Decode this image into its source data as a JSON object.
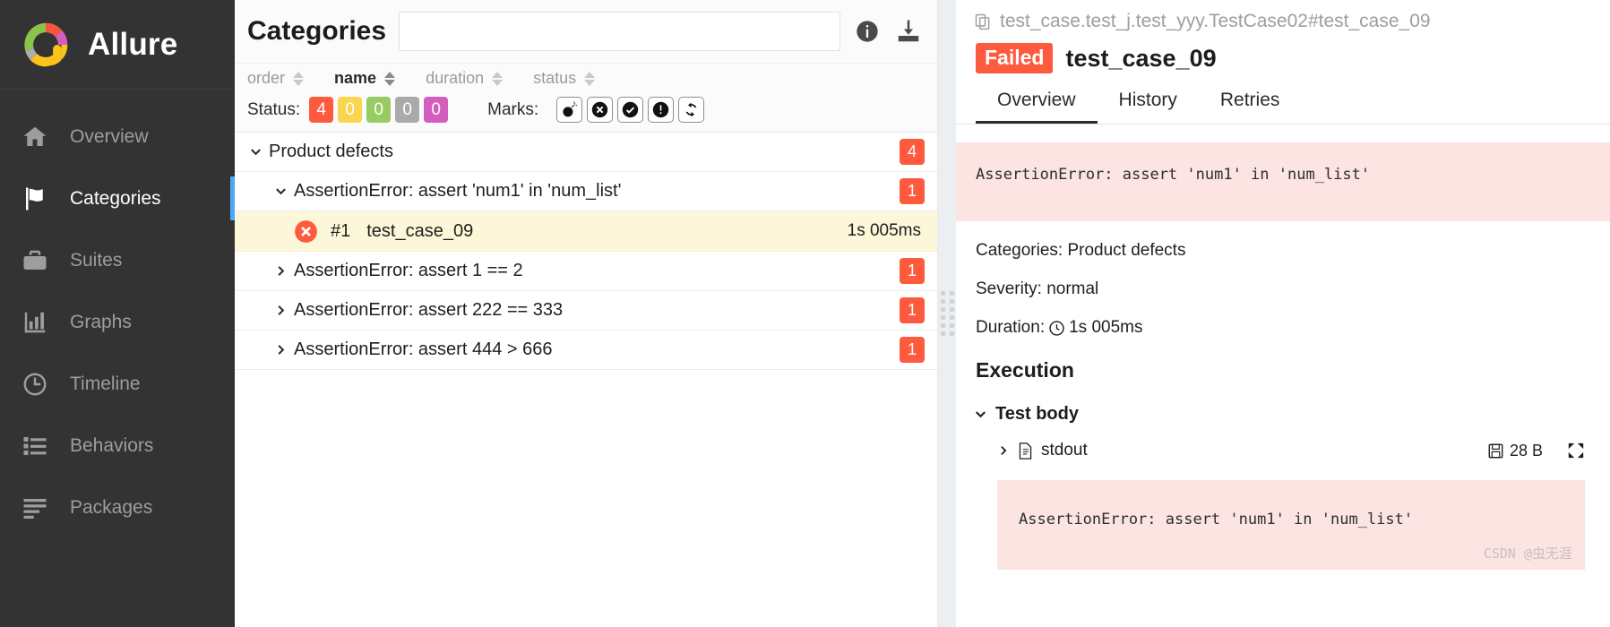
{
  "sidebar": {
    "brand": "Allure",
    "logo_icon": "allure-donut-logo",
    "items": [
      {
        "label": "Overview",
        "icon": "home-icon",
        "active": false
      },
      {
        "label": "Categories",
        "icon": "flag-icon",
        "active": true
      },
      {
        "label": "Suites",
        "icon": "briefcase-icon",
        "active": false
      },
      {
        "label": "Graphs",
        "icon": "bar-chart-icon",
        "active": false
      },
      {
        "label": "Timeline",
        "icon": "clock-icon",
        "active": false
      },
      {
        "label": "Behaviors",
        "icon": "list-icon",
        "active": false
      },
      {
        "label": "Packages",
        "icon": "lines-icon",
        "active": false
      }
    ]
  },
  "middle": {
    "title": "Categories",
    "search": {
      "value": "",
      "placeholder": ""
    },
    "info_icon": "info-circle-icon",
    "download_icon": "download-icon",
    "sort_columns": [
      {
        "label": "order",
        "active": false
      },
      {
        "label": "name",
        "active": true
      },
      {
        "label": "duration",
        "active": false
      },
      {
        "label": "status",
        "active": false
      }
    ],
    "status_filter": {
      "label": "Status:",
      "chips": [
        {
          "value": "4",
          "color": "#fd5a3e"
        },
        {
          "value": "0",
          "color": "#fcd550"
        },
        {
          "value": "0",
          "color": "#97cc64"
        },
        {
          "value": "0",
          "color": "#aaaaaa"
        },
        {
          "value": "0",
          "color": "#d35ebe"
        }
      ]
    },
    "marks_filter": {
      "label": "Marks:",
      "buttons": [
        {
          "icon": "bomb-icon"
        },
        {
          "icon": "times-circle-icon"
        },
        {
          "icon": "check-circle-icon"
        },
        {
          "icon": "exclamation-circle-icon"
        },
        {
          "icon": "retry-icon"
        }
      ]
    },
    "tree": [
      {
        "level": 0,
        "expanded": true,
        "name": "Product defects",
        "badge": "4"
      },
      {
        "level": 1,
        "expanded": true,
        "name": "AssertionError: assert 'num1' in 'num_list'",
        "badge": "1"
      },
      {
        "level": 2,
        "leaf": true,
        "status": "failed",
        "number": "#1",
        "name": "test_case_09",
        "duration": "1s 005ms"
      },
      {
        "level": 1,
        "expanded": false,
        "name": "AssertionError: assert 1 == 2",
        "badge": "1"
      },
      {
        "level": 1,
        "expanded": false,
        "name": "AssertionError: assert 222 == 333",
        "badge": "1"
      },
      {
        "level": 1,
        "expanded": false,
        "name": "AssertionError: assert 444 > 666",
        "badge": "1"
      }
    ]
  },
  "right": {
    "breadcrumb": "test_case.test_j.test_yyy.TestCase02#test_case_09",
    "breadcrumb_icon": "copy-icon",
    "status_badge": "Failed",
    "test_name": "test_case_09",
    "tabs": [
      {
        "label": "Overview",
        "active": true
      },
      {
        "label": "History",
        "active": false
      },
      {
        "label": "Retries",
        "active": false
      }
    ],
    "error_message": "AssertionError: assert 'num1' in 'num_list'",
    "meta": {
      "categories": "Categories: Product defects",
      "severity": "Severity: normal",
      "duration_label": "Duration:",
      "duration_icon": "clock-icon",
      "duration_value": "1s 005ms"
    },
    "execution_title": "Execution",
    "test_body": {
      "label": "Test body",
      "expanded": true
    },
    "attachment": {
      "name": "stdout",
      "file_icon": "file-icon",
      "save_icon": "save-icon",
      "size": "28 B",
      "expand_icon": "expand-icon"
    },
    "stdout_content": "AssertionError: assert 'num1' in 'num_list'",
    "watermark": "CSDN @虫无涯"
  },
  "colors": {
    "failed": "#fd5a3e",
    "broken": "#fcd550",
    "passed": "#97cc64",
    "skipped": "#aaaaaa",
    "unknown": "#d35ebe",
    "accent": "#4fa8f5",
    "error_bg": "#fbe4e2",
    "selected_row_bg": "#fcf7d8"
  }
}
